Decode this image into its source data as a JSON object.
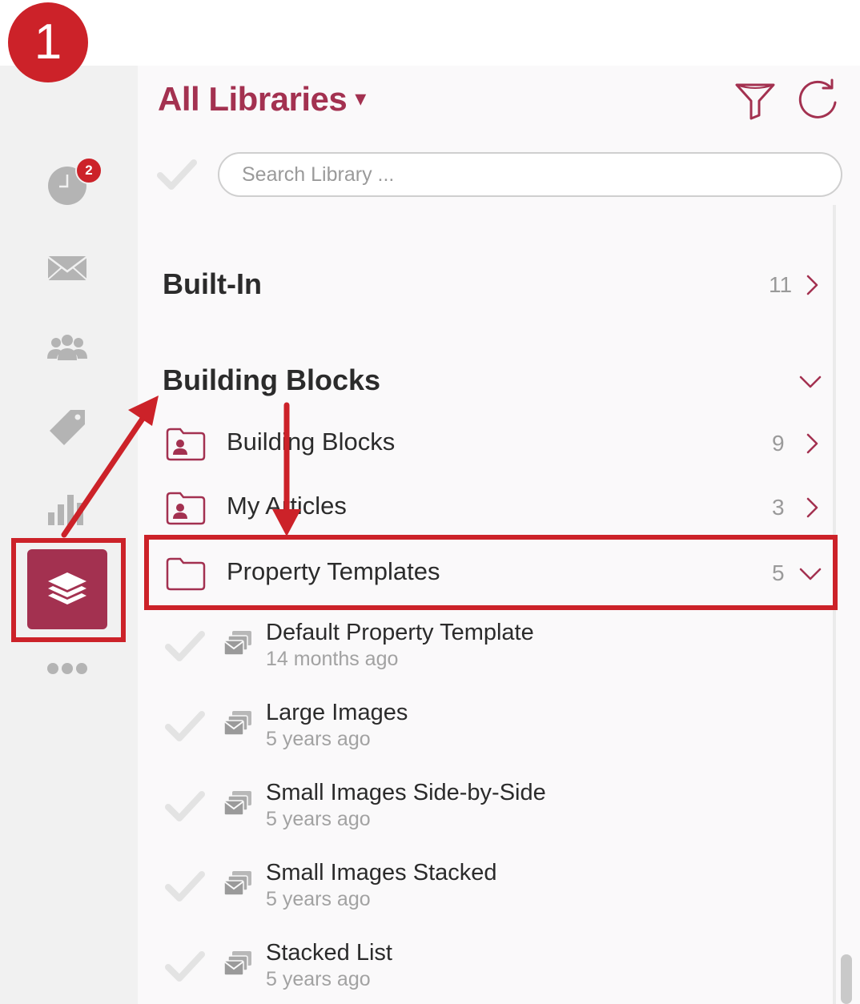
{
  "step_badge": "1",
  "rail": {
    "activity_badge": "2",
    "icons": [
      "clock-icon",
      "envelope-icon",
      "people-icon",
      "tag-icon",
      "bar-chart-icon",
      "layers-icon",
      "more-icon"
    ]
  },
  "header": {
    "title": "All Libraries",
    "caret": "▾"
  },
  "search": {
    "placeholder": "Search Library ..."
  },
  "sections": [
    {
      "title": "Built-In",
      "count": "11"
    },
    {
      "title": "Building Blocks"
    }
  ],
  "folders": [
    {
      "label": "Building Blocks",
      "count": "9"
    },
    {
      "label": "My Articles",
      "count": "3"
    },
    {
      "label": "Property Templates",
      "count": "5"
    }
  ],
  "templates": [
    {
      "title": "Default Property Template",
      "time": "14 months ago"
    },
    {
      "title": "Large Images",
      "time": "5 years ago"
    },
    {
      "title": "Small Images Side-by-Side",
      "time": "5 years ago"
    },
    {
      "title": "Small Images Stacked",
      "time": "5 years ago"
    },
    {
      "title": "Stacked List",
      "time": "5 years ago"
    }
  ],
  "colors": {
    "accent": "#a33150",
    "annotation": "#cc2229",
    "muted": "#9a9a9a"
  }
}
